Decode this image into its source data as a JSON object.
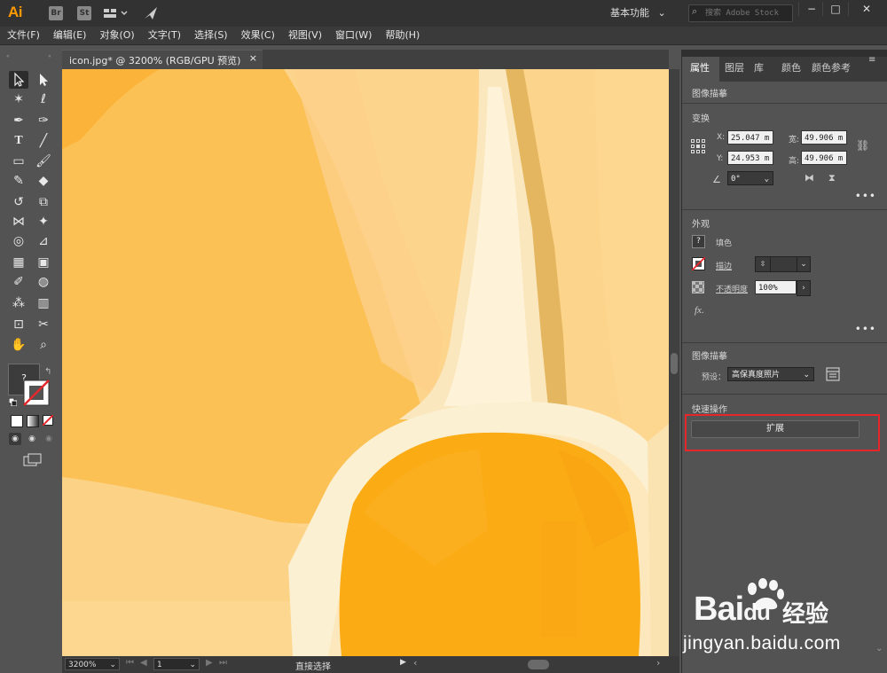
{
  "app": {
    "logo": "Ai",
    "bridge_icon": "Br",
    "stock_icon": "St",
    "workspace": "基本功能",
    "search_placeholder": "搜索 Adobe Stock"
  },
  "menu": [
    "文件(F)",
    "编辑(E)",
    "对象(O)",
    "文字(T)",
    "选择(S)",
    "效果(C)",
    "视图(V)",
    "窗口(W)",
    "帮助(H)"
  ],
  "document_tab": {
    "label": "icon.jpg* @ 3200% (RGB/GPU 预览)",
    "close": "×"
  },
  "status": {
    "zoom": "3200%",
    "artboard": "1",
    "tool": "直接选择"
  },
  "panel": {
    "tabs": [
      "属性",
      "图层",
      "库",
      "颜色",
      "颜色参考"
    ],
    "header": "图像描摹",
    "transform": {
      "title": "变换",
      "x_label": "X:",
      "x": "25.047 m",
      "y_label": "Y:",
      "y": "24.953 m",
      "w_label": "宽:",
      "w": "49.906 m",
      "h_label": "高:",
      "h": "49.906 m",
      "angle": "0°"
    },
    "appearance": {
      "title": "外观",
      "fill_label": "填色",
      "fill_icon": "?",
      "stroke_label": "描边",
      "opacity_label": "不透明度",
      "opacity": "100%",
      "fx": "fx."
    },
    "trace": {
      "title": "图像描摹",
      "preset_label": "预设：",
      "preset": "高保真度照片"
    },
    "quick": {
      "title": "快速操作",
      "expand": "扩展"
    },
    "more": "•••"
  },
  "watermark": {
    "baidu": "Bai",
    "du": "du",
    "jingyan": "经验",
    "url": "jingyan.baidu.com"
  },
  "colors": {
    "accent": "#ff9a00",
    "highlight": "#e8262a",
    "canvas_bg": "#fdd38a",
    "orange": "#fbad1a"
  },
  "icons": {
    "fill_unknown": "?"
  }
}
